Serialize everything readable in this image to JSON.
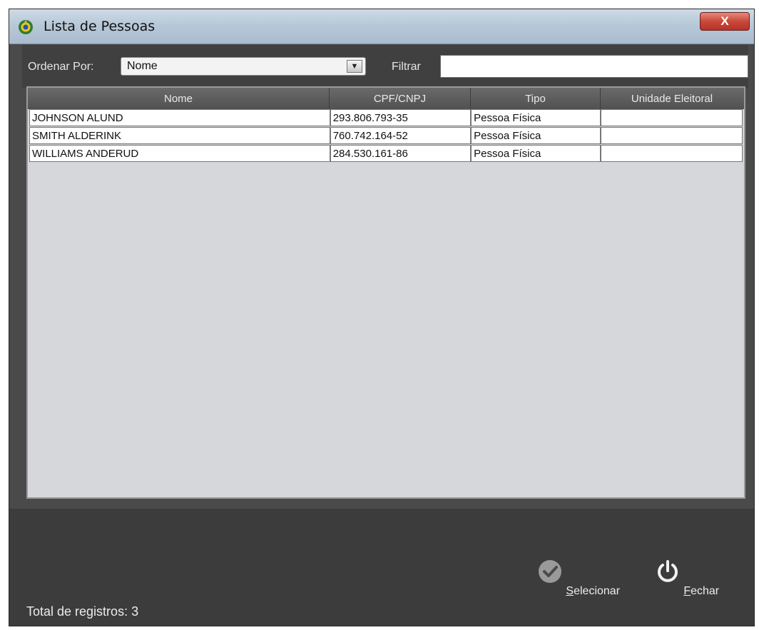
{
  "window": {
    "title": "Lista de Pessoas",
    "close_label": "X"
  },
  "filter": {
    "sort_label": "Ordenar Por:",
    "sort_selected": "Nome",
    "filter_label": "Filtrar",
    "filter_value": ""
  },
  "table": {
    "columns": [
      "Nome",
      "CPF/CNPJ",
      "Tipo",
      "Unidade Eleitoral"
    ],
    "rows": [
      {
        "nome": "JOHNSON ALUND",
        "cpf": "293.806.793-35",
        "tipo": "Pessoa Física",
        "unidade": ""
      },
      {
        "nome": "SMITH ALDERINK",
        "cpf": "760.742.164-52",
        "tipo": "Pessoa Física",
        "unidade": ""
      },
      {
        "nome": "WILLIAMS ANDERUD",
        "cpf": "284.530.161-86",
        "tipo": "Pessoa Física",
        "unidade": ""
      }
    ]
  },
  "footer": {
    "total_label": "Total de registros:",
    "total_value": "3",
    "select_label_first": "S",
    "select_label_rest": "elecionar",
    "close_label_first": "F",
    "close_label_rest": "echar"
  },
  "colors": {
    "window_bg": "#4a4a4a",
    "table_bg": "#d6d7da",
    "close_red": "#c9493a"
  },
  "icons": [
    "app-emblem-icon",
    "close-icon",
    "dropdown-arrow-icon",
    "check-icon",
    "power-icon"
  ]
}
